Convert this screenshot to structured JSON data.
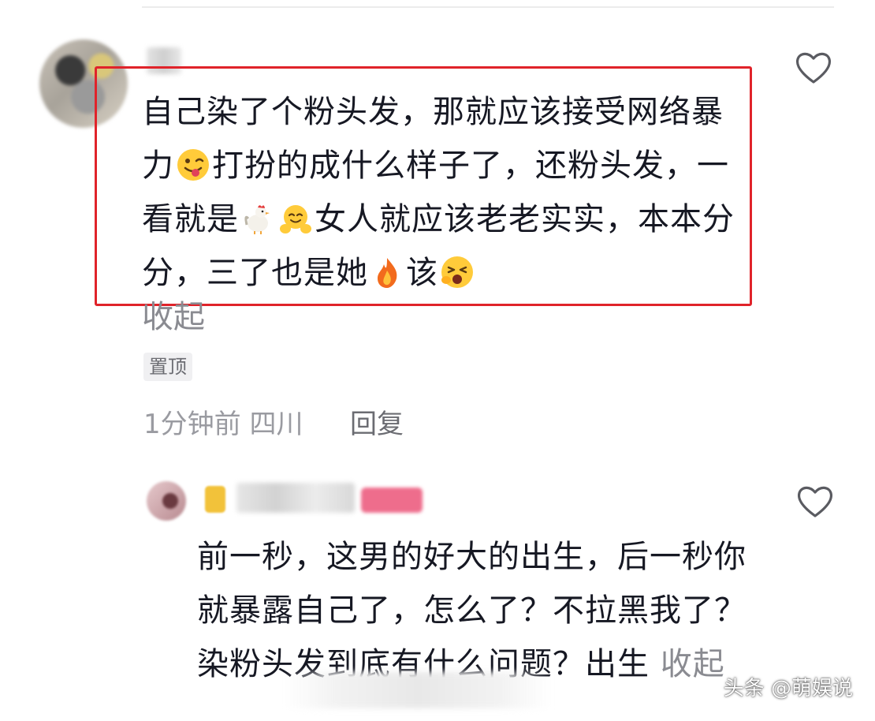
{
  "comments": [
    {
      "username": "",
      "text_segments": [
        "自己染了个粉头发，那就应该接受网络暴力",
        "打扮的成什么样子了，还粉头发，一看就是",
        "女人就应该老老实实，本本分分，三了也是她",
        "该"
      ],
      "emojis": [
        "winking-tongue-emoji",
        "rooster-emoji",
        "smiling-face-emoji",
        "fire-emoji",
        "yawning-face-emoji"
      ],
      "collapse_label": "收起",
      "pinned_label": "置顶",
      "time": "1分钟前",
      "location": "四川",
      "reply_label": "回复",
      "highlighted": true
    },
    {
      "username": "",
      "text": "前一秒，这男的好大的出生，后一秒你就暴露自己了，怎么了？不拉黑我了？染粉头发到底有什么问题？出生",
      "collapse_label": "收起"
    }
  ],
  "watermark": "头条 @萌娱说",
  "colors": {
    "highlight_border": "#e0232a",
    "text_primary": "#161823",
    "text_secondary": "#9a9ba1"
  }
}
